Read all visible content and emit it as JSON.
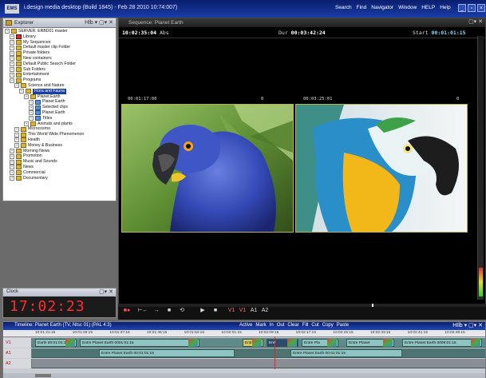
{
  "titlebar": {
    "logo": "EMS",
    "title": "i.design media desktop (Build 1845) - Feb 28 2010 10:74:007)",
    "menu": [
      "Search",
      "Find",
      "Navigator",
      "Window",
      "HELP",
      "Help"
    ]
  },
  "explorer": {
    "title": "Explorer",
    "controls": "Hlb  ▾  ▢▾  ✕",
    "items": [
      {
        "indent": 0,
        "label": "SERVER: ERBD01  master",
        "icon": "server"
      },
      {
        "indent": 1,
        "label": "Library",
        "icon": "red"
      },
      {
        "indent": 1,
        "label": "My Sequences",
        "icon": "folder"
      },
      {
        "indent": 1,
        "label": "Default master clip Folder",
        "icon": "folder"
      },
      {
        "indent": 1,
        "label": "Private folders",
        "icon": "folder"
      },
      {
        "indent": 1,
        "label": "New containers",
        "icon": "folder"
      },
      {
        "indent": 1,
        "label": "Default Public Search Folder",
        "icon": "folder"
      },
      {
        "indent": 1,
        "label": "Sub Folders",
        "icon": "folder"
      },
      {
        "indent": 1,
        "label": "Entertainment",
        "icon": "folder"
      },
      {
        "indent": 1,
        "label": "Programs",
        "icon": "folder"
      },
      {
        "indent": 2,
        "label": "Science and Nature",
        "icon": "folder"
      },
      {
        "indent": 3,
        "label": "Flora and Fauna",
        "icon": "folder",
        "selected": true
      },
      {
        "indent": 4,
        "label": "Planet Earth",
        "icon": "folder"
      },
      {
        "indent": 5,
        "label": "Planet Earth",
        "icon": "blue"
      },
      {
        "indent": 5,
        "label": "Selected clips",
        "icon": "blue"
      },
      {
        "indent": 5,
        "label": "Planet Earth",
        "icon": "blue"
      },
      {
        "indent": 5,
        "label": "Titles",
        "icon": "blue"
      },
      {
        "indent": 4,
        "label": "Animals and plants",
        "icon": "folder"
      },
      {
        "indent": 2,
        "label": "Microcosmo",
        "icon": "folder"
      },
      {
        "indent": 2,
        "label": "This World Wide Phenomenon",
        "icon": "folder"
      },
      {
        "indent": 2,
        "label": "Health",
        "icon": "folder"
      },
      {
        "indent": 2,
        "label": "Money & Business",
        "icon": "folder"
      },
      {
        "indent": 1,
        "label": "Morning News",
        "icon": "folder"
      },
      {
        "indent": 1,
        "label": "Promotion",
        "icon": "folder"
      },
      {
        "indent": 1,
        "label": "Music and Sounds",
        "icon": "folder"
      },
      {
        "indent": 1,
        "label": "News",
        "icon": "folder"
      },
      {
        "indent": 1,
        "label": "Commercial",
        "icon": "folder"
      },
      {
        "indent": 1,
        "label": "Documentary",
        "icon": "folder"
      }
    ]
  },
  "clock": {
    "title": "Clock",
    "controls": "▢▾  ✕",
    "time": "17:02:23"
  },
  "viewer": {
    "title": "Sequence: Planet Earth",
    "controls": "▢▾  ✕",
    "position_tc": "10:02:35:04",
    "position_label": "Abs",
    "duration_label": "Dur",
    "duration_tc": "00:03:42:24",
    "start_label": "Start",
    "start_tc": "00:01:01:15",
    "left_pane_tc": "00:01:17:00",
    "left_pane_value": "0",
    "right_pane_tc": "00:03:25:01",
    "right_pane_value": "0"
  },
  "transport": {
    "buttons": [
      "■●",
      "⊢←",
      "→",
      "■",
      "⟲",
      "▶",
      "■",
      "V1",
      "V1",
      "A1",
      "A2"
    ]
  },
  "timeline": {
    "title": "Timeline: Planet Earth (TV, Ntsc 01) (PAL 4:3)",
    "tools": [
      "Active",
      "Mark",
      "In",
      "Out",
      "Clear",
      "Fill",
      "Cut",
      "Copy",
      "Paste"
    ],
    "controls": "HIlb  ▾  ▢▾  ✕",
    "ruler": [
      "10:01:21:15",
      "10:01:29:15",
      "10:01:37:15",
      "10:01:45:15",
      "10:01:53:15",
      "10:02:01:15",
      "10:02:09:15",
      "10:02:17:15",
      "10:02:25:15",
      "10:02:33:15",
      "10:02:41:15",
      "10:02:49:15"
    ],
    "tracks": [
      {
        "label": "V1",
        "clips": [
          {
            "text": "Earth 00:01:01:15",
            "kind": "normal"
          },
          {
            "text": "Entre Planet Earth 0001:01:15",
            "kind": "normal"
          },
          {
            "text": "Entr",
            "kind": "yellow"
          },
          {
            "text": "Entr",
            "kind": "dark"
          },
          {
            "text": "Entre Pla",
            "kind": "normal"
          },
          {
            "text": "Entre Planet",
            "kind": "normal"
          },
          {
            "text": "Entre Planet Earth 0009:01:15",
            "kind": "normal"
          }
        ]
      },
      {
        "label": "A1",
        "clips": [
          {
            "text": "Entre Planet Earth 00:01:01:15",
            "kind": "normal"
          },
          {
            "text": "Entre Planet Earth 00:01:01:15",
            "kind": "normal"
          }
        ]
      },
      {
        "label": "A2",
        "clips": []
      }
    ]
  }
}
